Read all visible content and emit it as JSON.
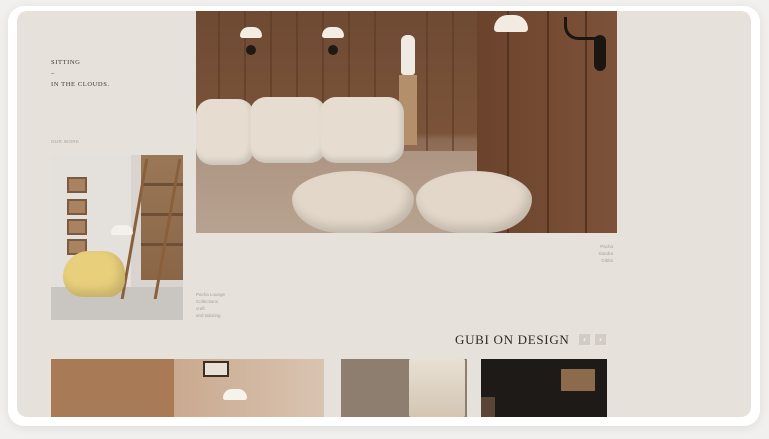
{
  "heading": {
    "line1": "SITTING",
    "line2": "–",
    "line3": "IN THE CLOUDS."
  },
  "section_label": "OUR WORK",
  "side_caption": [
    "Pacha",
    "Sandra",
    "Gibbs"
  ],
  "mid_caption": [
    "Pacha Lounge",
    "Collections",
    "craft",
    "and tailoring"
  ],
  "gubi_title": "GUBI ON DESIGN",
  "nav": {
    "prev": "‹",
    "next": "›"
  },
  "colors": {
    "background": "#e7e1dc",
    "wood": "#7a5339",
    "upholstery": "#e6ddd0",
    "yellow_chair": "#e8cf7c"
  }
}
